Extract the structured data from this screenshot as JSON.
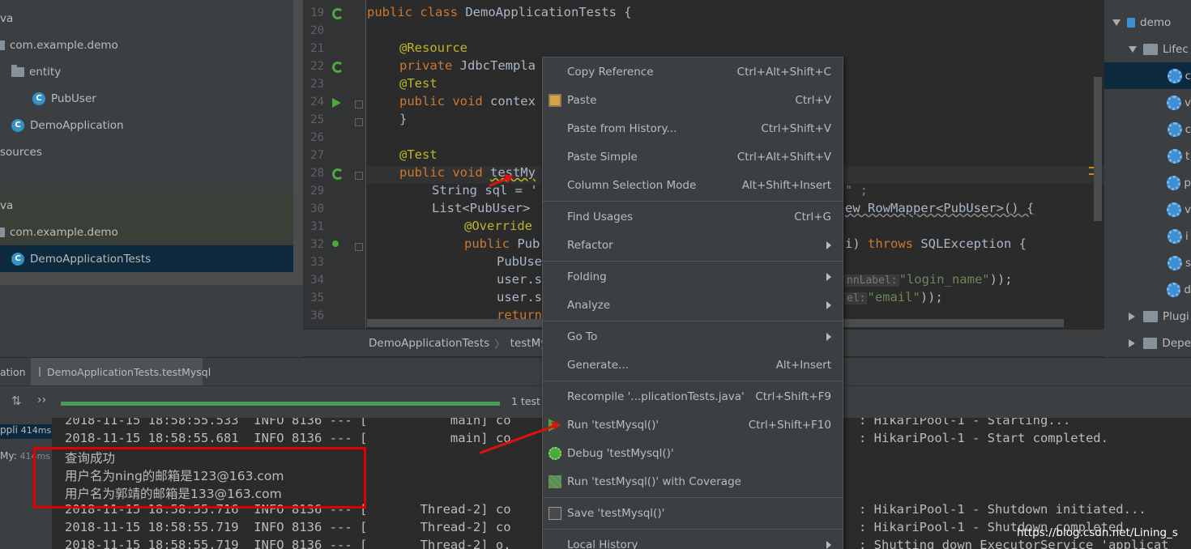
{
  "project_tree": {
    "rows": [
      {
        "label": "va"
      },
      {
        "label": "com.example.demo"
      },
      {
        "label": "entity"
      },
      {
        "label": "PubUser"
      },
      {
        "label": "DemoApplication"
      },
      {
        "label": "sources"
      },
      {
        "label": "va"
      },
      {
        "label": "com.example.demo"
      },
      {
        "label": "DemoApplicationTests"
      }
    ]
  },
  "editor": {
    "line_numbers": [
      "19",
      "20",
      "21",
      "22",
      "23",
      "24",
      "25",
      "26",
      "27",
      "28",
      "29",
      "30",
      "31",
      "32",
      "33",
      "34",
      "35",
      "36"
    ],
    "lines": {
      "l19_kw": "public class ",
      "l19_rest": "DemoApplicationTests {",
      "l21_an": "@Resource",
      "l22_kw": "private ",
      "l22_rest": "JdbcTempla",
      "l23_an": "@Test",
      "l24_kw": "public void ",
      "l24_rest": "contex",
      "l25": "}",
      "l27_an": "@Test",
      "l28_kw": "public void ",
      "l28_rest": "testMy",
      "l29_a": "String sql = '",
      "l29_b": "\" ;",
      "l30_a": "List<PubUser>",
      "l30_b": "ew RowMapper<PubUser>() {",
      "l31_an": "@Override",
      "l32_kw": "public ",
      "l32_rest": "Pub",
      "l32_b1": "i) ",
      "l32_b2": "throws ",
      "l32_b3": "SQLException {",
      "l33": "PubUse",
      "l34_a": "user.s",
      "l34_hint": "nnLabel:",
      "l34_str": "\"login_name\"",
      "l34_end": "));",
      "l35_a": "user.s",
      "l35_hint": "el:",
      "l35_str": "\"email\"",
      "l35_end": "));",
      "l36_kw": "return"
    }
  },
  "breadcrumb": {
    "class_name": "DemoApplicationTests",
    "separator": "〉",
    "method_name": "testMys"
  },
  "maven": {
    "root": "demo",
    "lifecycle": "Lifec",
    "goal_initials": [
      "c",
      "v",
      "c",
      "t",
      "p",
      "v",
      "i",
      "s",
      "d"
    ],
    "plugins": "Plugi",
    "dependencies": "Depe"
  },
  "tool_tabs": {
    "left_tab": "ation",
    "run_tab": "DemoApplicationTests.testMysql"
  },
  "run_toolbar": {
    "expand_symbol": "››",
    "result": "1 test"
  },
  "test_list": {
    "item1_name": "ppli",
    "item1_time": "414ms",
    "item2_name": "My:",
    "item2_time": "414ms"
  },
  "console": {
    "log1_left": "2018-11-15 18:58:55.533  INFO 8136 --- [           main] co",
    "log1_right": ": HikariPool-1 - Starting...",
    "log2_left": "2018-11-15 18:58:55.681  INFO 8136 --- [           main] co",
    "log2_right": ": HikariPool-1 - Start completed.",
    "out1": "查询成功",
    "out2": "用户名为ning的邮箱是123@163.com",
    "out3": "用户名为郭靖的邮箱是133@163.com",
    "log3_left": "2018-11-15 18:58:55.716  INFO 8136 --- [       Thread-2] co",
    "log3_right": ": HikariPool-1 - Shutdown initiated...",
    "log4_left": "2018-11-15 18:58:55.719  INFO 8136 --- [       Thread-2] co",
    "log4_right": ": HikariPool-1 - Shutdown completed.",
    "log5_left": "2018-11-15 18:58:55.719  INFO 8136 --- [       Thread-2] o.",
    "log5_right": ": Shutting down ExecutorService 'applicat"
  },
  "watermark": "https://blog.csdn.net/Lining_s",
  "context_menu": {
    "items": [
      {
        "label": "Copy Reference",
        "shortcut": "Ctrl+Alt+Shift+C"
      },
      {
        "label": "Paste",
        "shortcut": "Ctrl+V"
      },
      {
        "label": "Paste from History...",
        "shortcut": "Ctrl+Shift+V"
      },
      {
        "label": "Paste Simple",
        "shortcut": "Ctrl+Alt+Shift+V"
      },
      {
        "label": "Column Selection Mode",
        "shortcut": "Alt+Shift+Insert"
      },
      {
        "label": "Find Usages",
        "shortcut": "Ctrl+G"
      },
      {
        "label": "Refactor",
        "shortcut": ""
      },
      {
        "label": "Folding",
        "shortcut": ""
      },
      {
        "label": "Analyze",
        "shortcut": ""
      },
      {
        "label": "Go To",
        "shortcut": ""
      },
      {
        "label": "Generate...",
        "shortcut": "Alt+Insert"
      },
      {
        "label": "Recompile '...plicationTests.java'",
        "shortcut": "Ctrl+Shift+F9"
      },
      {
        "label": "Run 'testMysql()'",
        "shortcut": "Ctrl+Shift+F10"
      },
      {
        "label": "Debug 'testMysql()'",
        "shortcut": ""
      },
      {
        "label": "Run 'testMysql()' with Coverage",
        "shortcut": ""
      },
      {
        "label": "Save 'testMysql()'",
        "shortcut": ""
      },
      {
        "label": "Local History",
        "shortcut": ""
      }
    ]
  },
  "colors": {
    "keyword": "#cc7832",
    "annotation": "#bbb529",
    "string": "#6a8759",
    "run_green": "#4aa93a",
    "annotation_red": "#e00000"
  }
}
